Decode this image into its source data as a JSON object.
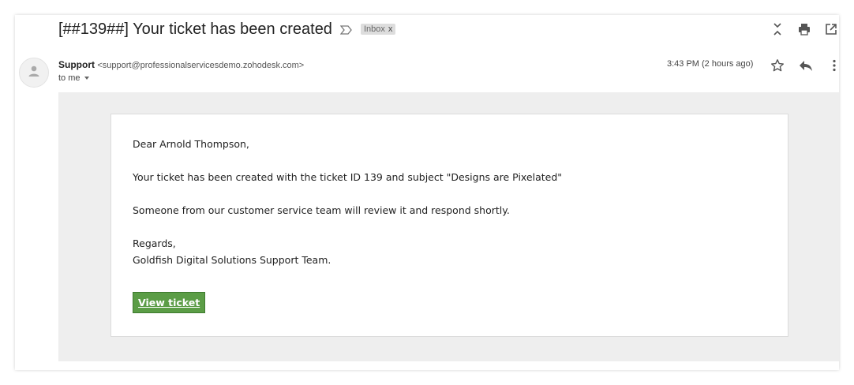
{
  "email": {
    "subject": "[##139##] Your ticket has been created",
    "label": "Inbox",
    "label_close": "x",
    "sender_name": "Support",
    "sender_email": "<support@professionalservicesdemo.zohodesk.com>",
    "to_line": "to me",
    "time": "3:43 PM (2 hours ago)"
  },
  "message": {
    "greeting": "Dear Arnold Thompson,",
    "line1": "Your ticket has been created with the ticket ID 139 and subject \"Designs are Pixelated\"",
    "line2": "Someone from our customer service team will review it and respond shortly.",
    "regards": "Regards,",
    "signature": "Goldfish Digital Solutions Support Team.",
    "button_label": "View ticket"
  },
  "icons": {
    "important": "importance-marker-icon",
    "collapse": "collapse-all-icon",
    "print": "print-icon",
    "new_window": "open-in-new-window-icon",
    "avatar": "person-avatar-icon",
    "dropdown": "chevron-down-icon",
    "star": "star-icon",
    "reply": "reply-icon",
    "more": "more-vertical-icon"
  },
  "colors": {
    "button_bg": "#5b9d46",
    "body_bg": "#eeeeee",
    "label_bg": "#dddddd"
  }
}
